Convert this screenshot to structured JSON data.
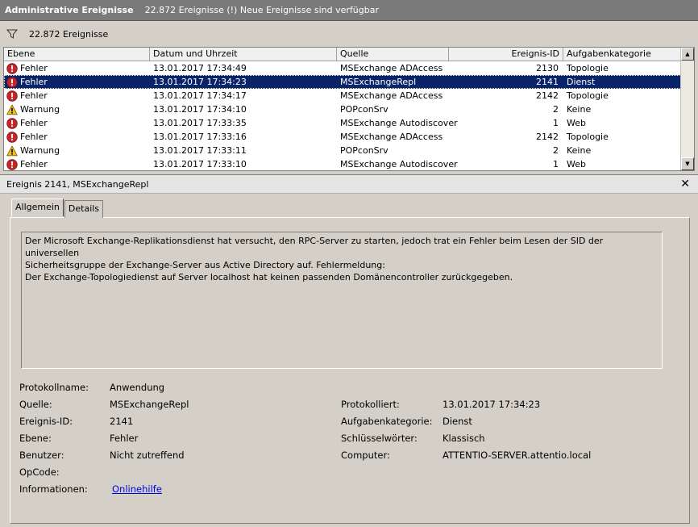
{
  "titlebar": {
    "title": "Administrative Ereignisse",
    "status": "22.872 Ereignisse (!) Neue Ereignisse sind verfügbar"
  },
  "filter": {
    "count_text": "22.872 Ereignisse"
  },
  "grid": {
    "columns": [
      "Ebene",
      "Datum und Uhrzeit",
      "Quelle",
      "Ereignis-ID",
      "Aufgabenkategorie"
    ],
    "rows": [
      {
        "level": "Fehler",
        "icon": "error-icon",
        "date": "13.01.2017 17:34:49",
        "source": "MSExchange ADAccess",
        "id": "2130",
        "category": "Topologie"
      },
      {
        "level": "Fehler",
        "icon": "error-icon",
        "date": "13.01.2017 17:34:23",
        "source": "MSExchangeRepl",
        "id": "2141",
        "category": "Dienst",
        "selected": true
      },
      {
        "level": "Fehler",
        "icon": "error-icon",
        "date": "13.01.2017 17:34:17",
        "source": "MSExchange ADAccess",
        "id": "2142",
        "category": "Topologie"
      },
      {
        "level": "Warnung",
        "icon": "warning-icon",
        "date": "13.01.2017 17:34:10",
        "source": "POPconSrv",
        "id": "2",
        "category": "Keine"
      },
      {
        "level": "Fehler",
        "icon": "error-icon",
        "date": "13.01.2017 17:33:35",
        "source": "MSExchange Autodiscover",
        "id": "1",
        "category": "Web"
      },
      {
        "level": "Fehler",
        "icon": "error-icon",
        "date": "13.01.2017 17:33:16",
        "source": "MSExchange ADAccess",
        "id": "2142",
        "category": "Topologie"
      },
      {
        "level": "Warnung",
        "icon": "warning-icon",
        "date": "13.01.2017 17:33:11",
        "source": "POPconSrv",
        "id": "2",
        "category": "Keine"
      },
      {
        "level": "Fehler",
        "icon": "error-icon",
        "date": "13.01.2017 17:33:10",
        "source": "MSExchange Autodiscover",
        "id": "1",
        "category": "Web"
      }
    ]
  },
  "detail": {
    "header": "Ereignis 2141, MSExchangeRepl",
    "tabs": [
      "Allgemein",
      "Details"
    ],
    "description": "Der Microsoft Exchange-Replikationsdienst hat versucht, den RPC-Server zu starten, jedoch trat ein Fehler beim Lesen der SID der universellen\nSicherheitsgruppe der Exchange-Server aus Active Directory auf. Fehlermeldung:\nDer Exchange-Topologiedienst auf Server localhost hat keinen passenden Domänencontroller zurückgegeben.",
    "props": {
      "protokollname_label": "Protokollname:",
      "protokollname": "Anwendung",
      "quelle_label": "Quelle:",
      "quelle": "MSExchangeRepl",
      "protokolliert_label": "Protokolliert:",
      "protokolliert": "13.01.2017 17:34:23",
      "ereignis_id_label": "Ereignis-ID:",
      "ereignis_id": "2141",
      "aufgabenkategorie_label": "Aufgabenkategorie:",
      "aufgabenkategorie": "Dienst",
      "ebene_label": "Ebene:",
      "ebene": "Fehler",
      "schluesselwoerter_label": "Schlüsselwörter:",
      "schluesselwoerter": "Klassisch",
      "benutzer_label": "Benutzer:",
      "benutzer": "Nicht zutreffend",
      "computer_label": "Computer:",
      "computer": "ATTENTIO-SERVER.attentio.local",
      "opcode_label": "OpCode:",
      "informationen_label": "Informationen:",
      "informationen_link": "Onlinehilfe"
    }
  },
  "colors": {
    "selection": "#0a246a",
    "error": "#c0282a",
    "warning": "#f0c020",
    "link": "#0000ee"
  }
}
